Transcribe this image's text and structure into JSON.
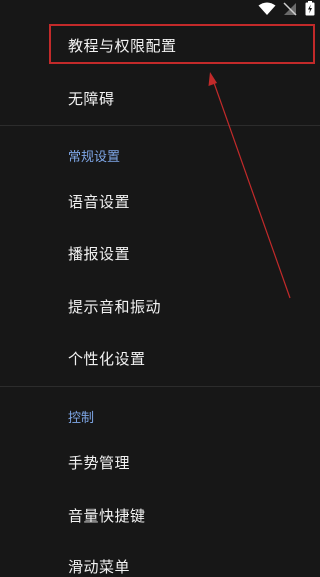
{
  "status_bar": {
    "icons": [
      "wifi-icon",
      "no-sim-icon",
      "battery-icon"
    ]
  },
  "menu": {
    "tutorial_permissions": "教程与权限配置",
    "accessibility": "无障碍",
    "general_header": "常规设置",
    "voice_settings": "语音设置",
    "broadcast_settings": "播报设置",
    "sound_vibration": "提示音和振动",
    "personalization": "个性化设置",
    "control_header": "控制",
    "gesture_management": "手势管理",
    "volume_shortcut": "音量快捷键",
    "swipe_menu": "滑动菜单"
  },
  "colors": {
    "background": "#171717",
    "section_header": "#7ea6e6",
    "annotation_red": "#c22a2a"
  }
}
